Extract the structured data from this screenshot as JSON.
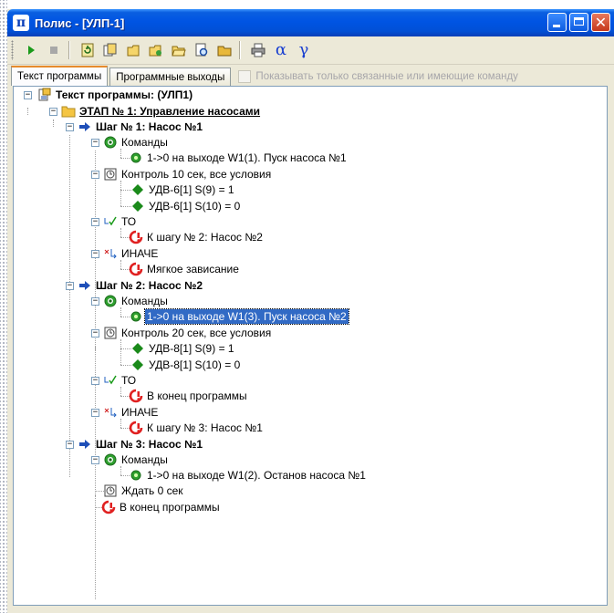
{
  "window": {
    "app_icon": "π",
    "title": "Полис - [УЛП-1]"
  },
  "toolbar": {
    "buttons": [
      "play-icon",
      "stop-icon",
      "refresh-icon",
      "copy-icon",
      "new-icon",
      "paste-icon",
      "open-icon",
      "print-preview-icon",
      "folder-icon",
      "print-icon"
    ],
    "alpha": "α",
    "gamma": "γ"
  },
  "tabs": {
    "program_text": "Текст программы",
    "program_outputs": "Программные выходы",
    "filter_checkbox_label": "Показывать только связанные или имеющие команду",
    "filter_checked": false
  },
  "tree": {
    "root": "Текст программы:  (УЛП1)",
    "stage": "ЭТАП № 1: Управление насосами",
    "step1": {
      "title": "Шаг № 1: Насос №1",
      "commands": "Команды",
      "command1": "1->0 на выходе W1(1). Пуск насоса №1",
      "control": "Контроль 10 сек, все условия",
      "cond1": "УДВ-6[1] S(9) = 1",
      "cond2": "УДВ-6[1] S(10) = 0",
      "then": "ТО",
      "then_action": "К шагу № 2: Насос №2",
      "else": "ИНАЧЕ",
      "else_action": "Мягкое зависание"
    },
    "step2": {
      "title": "Шаг № 2: Насос №2",
      "commands": "Команды",
      "command1": "1->0 на выходе W1(3). Пуск насоса №2",
      "control": "Контроль 20 сек, все условия",
      "cond1": "УДВ-8[1] S(9) = 1",
      "cond2": "УДВ-8[1] S(10) = 0",
      "then": "ТО",
      "then_action": "В конец программы",
      "else": "ИНАЧЕ",
      "else_action": "К шагу № 3: Насос №1"
    },
    "step3": {
      "title": "Шаг № 3: Насос №1",
      "commands": "Команды",
      "command1": "1->0 на выходе W1(2). Останов насоса №1",
      "wait": "Ждать 0 сек",
      "end": "В конец программы"
    },
    "selected_item": "1->0 на выходе W1(3). Пуск насоса №2",
    "colors": {
      "selection": "#316ac5",
      "step_arrow": "#1e4fb8",
      "condition_diamond": "#1a8a1a",
      "command_icon": "#2fa02f",
      "action_icon": "#e02020",
      "folder": "#f5c542"
    }
  }
}
